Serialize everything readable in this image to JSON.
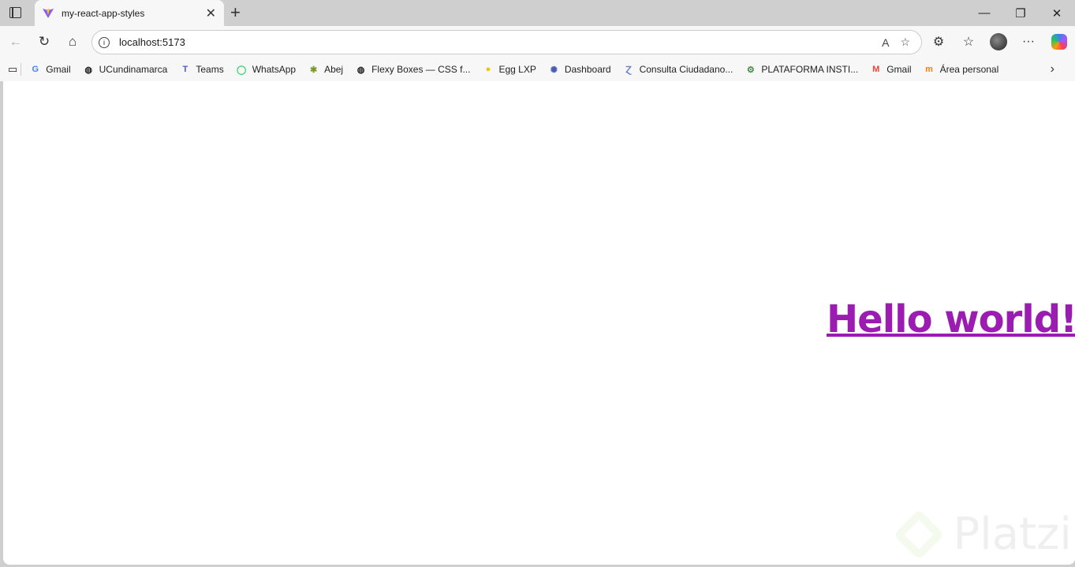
{
  "browser": {
    "tab_title": "my-react-app-styles",
    "url": "localhost:5173"
  },
  "bookmarks": [
    {
      "label": "Gmail",
      "icon": "google-icon"
    },
    {
      "label": "UCundinamarca",
      "icon": "globe-icon"
    },
    {
      "label": "Teams",
      "icon": "teams-icon"
    },
    {
      "label": "WhatsApp",
      "icon": "whatsapp-icon"
    },
    {
      "label": "Abej",
      "icon": "bee-icon"
    },
    {
      "label": "Flexy Boxes — CSS f...",
      "icon": "globe-icon"
    },
    {
      "label": "Egg LXP",
      "icon": "egg-icon"
    },
    {
      "label": "Dashboard",
      "icon": "dashboard-icon"
    },
    {
      "label": "Consulta Ciudadano...",
      "icon": "consulta-icon"
    },
    {
      "label": "PLATAFORMA INSTI...",
      "icon": "gear-icon"
    },
    {
      "label": "Gmail",
      "icon": "gmail-icon"
    },
    {
      "label": "Área personal",
      "icon": "moodle-icon"
    }
  ],
  "page": {
    "heading": "Hello world!",
    "heading_color": "#9b1cb0",
    "watermark": "Platzi"
  }
}
